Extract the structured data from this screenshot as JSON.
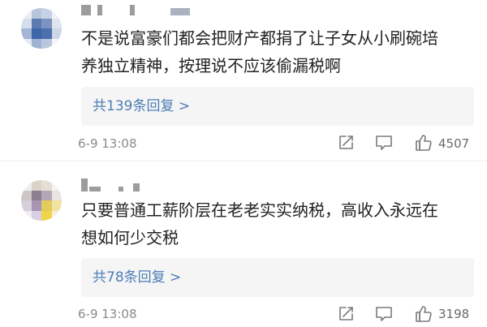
{
  "comments": [
    {
      "text": "不是说富豪们都会把财产都捐了让子女从小刷碗培\n养独立精神，按理说不应该偷漏税啊",
      "replies_label": "共139条回复 >",
      "time": "6-9 13:08",
      "likes": "4507",
      "avatar_colors": [
        "#e9eef5",
        "#b8c6dd",
        "#c7d1e4",
        "#eef1f6",
        "#d5deec",
        "#5b7bb3",
        "#7e93c0",
        "#dfe5ef",
        "#a3b6d6",
        "#3f66a8",
        "#4d6fae",
        "#cdd6e7",
        "#e5eaf2",
        "#9fb2d3",
        "#bac6dd",
        "#f1f3f7"
      ]
    },
    {
      "text": "只要普通工薪阶层在老老实实纳税，高收入永远在\n想如何少交税",
      "replies_label": "共78条回复 >",
      "time": "6-9 13:08",
      "likes": "3198",
      "avatar_colors": [
        "#eeeeee",
        "#d9d3c8",
        "#e4ded3",
        "#f3f3f3",
        "#cfc6c6",
        "#8a7f8f",
        "#b3a7b5",
        "#e8e4e0",
        "#d7cfd9",
        "#a895b4",
        "#e2cc5b",
        "#f2e3a0",
        "#eeeeee",
        "#d9cfe2",
        "#f0d54a",
        "#f5f0dc"
      ]
    }
  ],
  "colors": {
    "link": "#4d7eb6",
    "meta": "#8a8a8a",
    "reply_bg": "#f5f5f5"
  },
  "icons": [
    "share-icon",
    "comment-icon",
    "like-icon"
  ]
}
